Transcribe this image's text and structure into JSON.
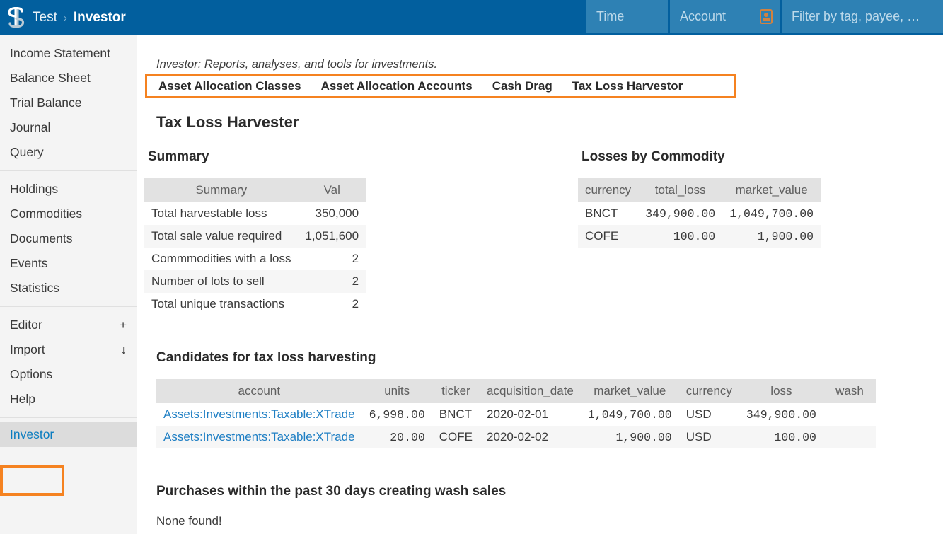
{
  "header": {
    "logo_icon": "fava-dollar-ledger-icon",
    "breadcrumb": {
      "root": "Test",
      "separator": "›",
      "current": "Investor"
    },
    "time_placeholder": "Time",
    "account_placeholder": "Account",
    "account_icon": "account-card-icon",
    "filter_placeholder": "Filter by tag, payee, …"
  },
  "sidebar": {
    "group1": [
      {
        "label": "Income Statement"
      },
      {
        "label": "Balance Sheet"
      },
      {
        "label": "Trial Balance"
      },
      {
        "label": "Journal"
      },
      {
        "label": "Query"
      }
    ],
    "group2": [
      {
        "label": "Holdings"
      },
      {
        "label": "Commodities"
      },
      {
        "label": "Documents"
      },
      {
        "label": "Events"
      },
      {
        "label": "Statistics"
      }
    ],
    "group3": [
      {
        "label": "Editor",
        "extra": "+"
      },
      {
        "label": "Import",
        "extra": "↓"
      },
      {
        "label": "Options",
        "extra": ""
      },
      {
        "label": "Help",
        "extra": ""
      }
    ],
    "group4": [
      {
        "label": "Investor"
      }
    ]
  },
  "main": {
    "subtitle": "Investor: Reports, analyses, and tools for investments.",
    "tabs": [
      {
        "label": "Asset Allocation Classes"
      },
      {
        "label": "Asset Allocation Accounts"
      },
      {
        "label": "Cash Drag"
      },
      {
        "label": "Tax Loss Harvestor"
      }
    ],
    "page_title": "Tax Loss Harvester",
    "summary": {
      "heading": "Summary",
      "columns": [
        "Summary",
        "Val"
      ],
      "rows": [
        {
          "label": "Total harvestable loss",
          "value": "350,000"
        },
        {
          "label": "Total sale value required",
          "value": "1,051,600"
        },
        {
          "label": "Commmodities with a loss",
          "value": "2"
        },
        {
          "label": "Number of lots to sell",
          "value": "2"
        },
        {
          "label": "Total unique transactions",
          "value": "2"
        }
      ]
    },
    "losses": {
      "heading": "Losses by Commodity",
      "columns": [
        "currency",
        "total_loss",
        "market_value"
      ],
      "rows": [
        {
          "currency": "BNCT",
          "total_loss": "349,900.00",
          "market_value": "1,049,700.00"
        },
        {
          "currency": "COFE",
          "total_loss": "100.00",
          "market_value": "1,900.00"
        }
      ]
    },
    "candidates": {
      "heading": "Candidates for tax loss harvesting",
      "columns": [
        "account",
        "units",
        "ticker",
        "acquisition_date",
        "market_value",
        "currency",
        "loss",
        "wash"
      ],
      "rows": [
        {
          "account": "Assets:Investments:Taxable:XTrade",
          "units": "6,998.00",
          "ticker": "BNCT",
          "acquisition_date": "2020-02-01",
          "market_value": "1,049,700.00",
          "currency": "USD",
          "loss": "349,900.00",
          "wash": ""
        },
        {
          "account": "Assets:Investments:Taxable:XTrade",
          "units": "20.00",
          "ticker": "COFE",
          "acquisition_date": "2020-02-02",
          "market_value": "1,900.00",
          "currency": "USD",
          "loss": "100.00",
          "wash": ""
        }
      ]
    },
    "wash": {
      "heading": "Purchases within the past 30 days creating wash sales",
      "empty_text": "None found!"
    }
  },
  "colors": {
    "header_blue": "#025f9e",
    "field_blue": "#2e81b4",
    "highlight_orange": "#f58220",
    "link_blue": "#1f7fc4",
    "sidebar_bg": "#f4f4f4"
  }
}
